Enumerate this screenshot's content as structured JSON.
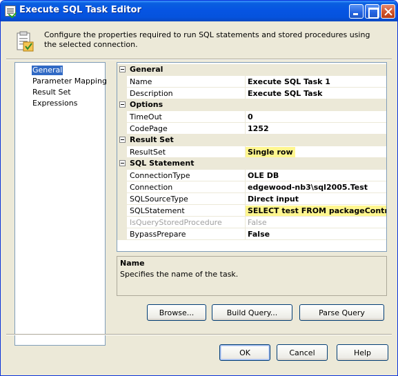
{
  "window": {
    "title": "Execute SQL Task Editor",
    "header_text": "Configure the properties required to run SQL statements and stored procedures using the selected connection."
  },
  "nav": {
    "items": [
      {
        "label": "General",
        "selected": true
      },
      {
        "label": "Parameter Mapping",
        "selected": false
      },
      {
        "label": "Result Set",
        "selected": false
      },
      {
        "label": "Expressions",
        "selected": false
      }
    ]
  },
  "properties": {
    "general": {
      "label": "General",
      "name": {
        "label": "Name",
        "value": "Execute SQL Task 1"
      },
      "description": {
        "label": "Description",
        "value": "Execute SQL Task"
      }
    },
    "options": {
      "label": "Options",
      "timeout": {
        "label": "TimeOut",
        "value": "0"
      },
      "codepage": {
        "label": "CodePage",
        "value": "1252"
      }
    },
    "result_set": {
      "label": "Result Set",
      "resultset": {
        "label": "ResultSet",
        "value": "Single row"
      }
    },
    "sql_statement": {
      "label": "SQL Statement",
      "connection_type": {
        "label": "ConnectionType",
        "value": "OLE DB"
      },
      "connection": {
        "label": "Connection",
        "value": "edgewood-nb3\\sql2005.Test"
      },
      "sql_source_type": {
        "label": "SQLSourceType",
        "value": "Direct input"
      },
      "sql_statement": {
        "label": "SQLStatement",
        "value": "SELECT test FROM packageControls"
      },
      "is_query_stored_procedure": {
        "label": "IsQueryStoredProcedure",
        "value": "False"
      },
      "bypass_prepare": {
        "label": "BypassPrepare",
        "value": "False"
      }
    }
  },
  "description_panel": {
    "title": "Name",
    "text": "Specifies the name of the task."
  },
  "buttons": {
    "browse": "Browse...",
    "build_query": "Build Query...",
    "parse_query": "Parse Query",
    "ok": "OK",
    "cancel": "Cancel",
    "help": "Help"
  },
  "colors": {
    "highlight": "#fff68f",
    "selection": "#316ac5",
    "titlebar": "#0654e2"
  }
}
